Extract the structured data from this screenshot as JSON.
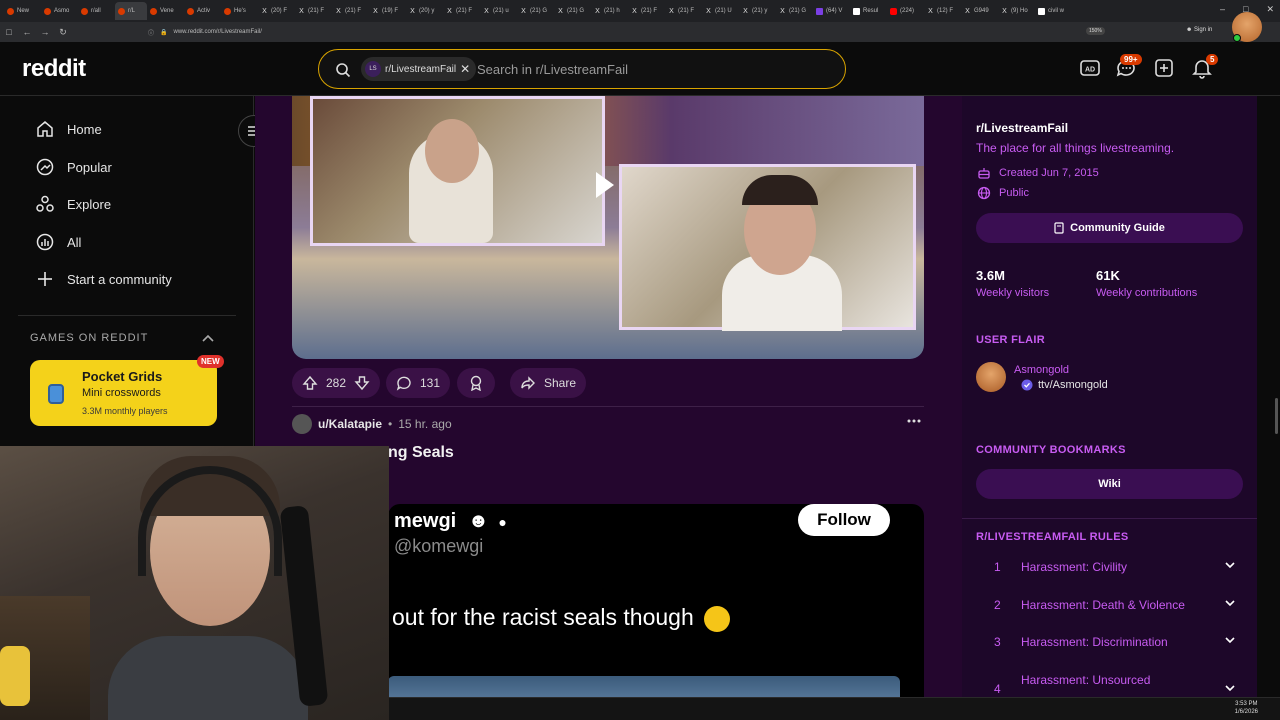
{
  "browser": {
    "tabs": [
      {
        "label": "New",
        "icon": "reddit-icon"
      },
      {
        "label": "Asmo",
        "icon": "reddit-icon"
      },
      {
        "label": "r/all",
        "icon": "reddit-icon"
      },
      {
        "label": "r/L",
        "icon": "reddit-icon",
        "active": true
      },
      {
        "label": "Vene",
        "icon": "reddit-icon"
      },
      {
        "label": "Activ",
        "icon": "reddit-icon"
      },
      {
        "label": "He's",
        "icon": "reddit-icon"
      },
      {
        "label": "(20) F",
        "icon": "x-icon"
      },
      {
        "label": "(21) F",
        "icon": "x-icon"
      },
      {
        "label": "(21) F",
        "icon": "x-icon"
      },
      {
        "label": "(19) F",
        "icon": "x-icon"
      },
      {
        "label": "(20) y",
        "icon": "x-icon"
      },
      {
        "label": "(21) F",
        "icon": "x-icon"
      },
      {
        "label": "(21) u",
        "icon": "x-icon"
      },
      {
        "label": "(21) G",
        "icon": "x-icon"
      },
      {
        "label": "(21) G",
        "icon": "x-icon"
      },
      {
        "label": "(21) h",
        "icon": "x-icon"
      },
      {
        "label": "(21) F",
        "icon": "x-icon"
      },
      {
        "label": "(21) F",
        "icon": "x-icon"
      },
      {
        "label": "(21) U",
        "icon": "x-icon"
      },
      {
        "label": "(21) y",
        "icon": "x-icon"
      },
      {
        "label": "(21) G",
        "icon": "x-icon"
      },
      {
        "label": "(64) V",
        "icon": "twitch-icon"
      },
      {
        "label": "Resul",
        "icon": "google-icon"
      },
      {
        "label": "(224)",
        "icon": "youtube-icon"
      },
      {
        "label": "(12) F",
        "icon": "x-icon"
      },
      {
        "label": "G949",
        "icon": "x-icon"
      },
      {
        "label": "(9) Ho",
        "icon": "x-icon"
      },
      {
        "label": "civil w",
        "icon": "google-icon"
      }
    ],
    "url": "www.reddit.com/r/LivestreamFail/",
    "zoom": "150%",
    "signin": "Sign in"
  },
  "header": {
    "logo": "reddit",
    "search_chip": "r/LivestreamFail",
    "search_chip_avatar": "LS",
    "search_placeholder": "Search in r/LivestreamFail",
    "chat_badge": "99+",
    "notif_badge": "5"
  },
  "leftnav": {
    "items": [
      {
        "label": "Home",
        "icon": "home-icon"
      },
      {
        "label": "Popular",
        "icon": "popular-icon"
      },
      {
        "label": "Explore",
        "icon": "explore-icon"
      },
      {
        "label": "All",
        "icon": "all-icon"
      },
      {
        "label": "Start a community",
        "icon": "plus-icon"
      }
    ],
    "games_heading": "GAMES ON REDDIT",
    "game": {
      "title": "Pocket Grids",
      "subtitle": "Mini crosswords",
      "players": "3.3M monthly players",
      "badge": "NEW"
    }
  },
  "feed": {
    "post1": {
      "upvotes": "282",
      "comments": "131",
      "share_label": "Share"
    },
    "post2": {
      "author": "u/Kalatapie",
      "time": "15 hr. ago",
      "title_visible": "ng Seals",
      "tweet_name": "mewgi",
      "tweet_handle": "@komewgi",
      "tweet_text": "out for the racist seals though",
      "follow_label": "Follow"
    }
  },
  "sidebar": {
    "community_name": "r/LivestreamFail",
    "description": "The place for all things livestreaming.",
    "created": "Created Jun 7, 2015",
    "visibility": "Public",
    "guide_button": "Community Guide",
    "stats": [
      {
        "value": "3.6M",
        "label": "Weekly visitors"
      },
      {
        "value": "61K",
        "label": "Weekly contributions"
      }
    ],
    "user_flair_heading": "USER FLAIR",
    "flair_user": "Asmongold",
    "flair_text": "ttv/Asmongold",
    "bookmarks_heading": "COMMUNITY BOOKMARKS",
    "wiki_button": "Wiki",
    "rules_heading": "R/LIVESTREAMFAIL RULES",
    "rules": [
      {
        "num": "1",
        "text": "Harassment: Civility"
      },
      {
        "num": "2",
        "text": "Harassment: Death & Violence"
      },
      {
        "num": "3",
        "text": "Harassment: Discrimination"
      },
      {
        "num": "4",
        "text": "Harassment: Unsourced"
      }
    ]
  },
  "taskbar": {
    "time": "3:53 PM",
    "date": "1/6/2026"
  },
  "colors": {
    "accent": "#c85cf2",
    "feed_bg": "#24062e",
    "sidebar_card": "#1d0729",
    "search_border": "#d9a400",
    "badge": "#d93a00"
  }
}
